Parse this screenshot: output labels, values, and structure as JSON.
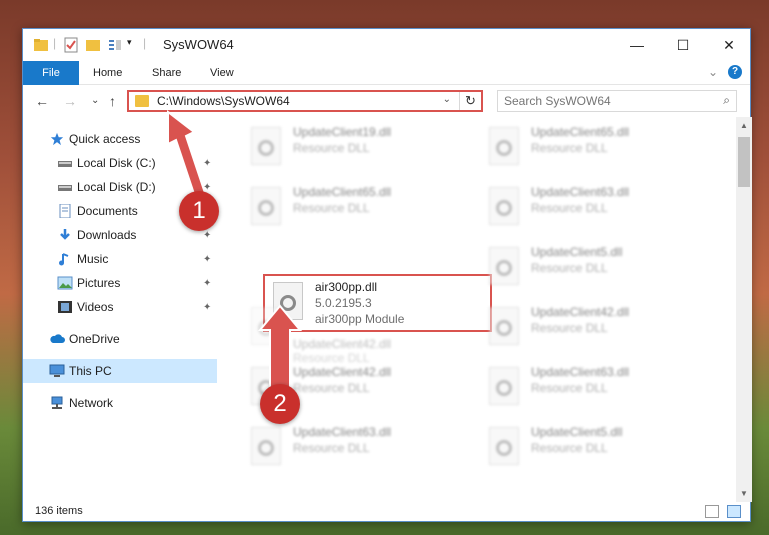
{
  "window": {
    "title": "SysWOW64",
    "controls": {
      "minimize": "—",
      "maximize": "☐",
      "close": "✕"
    }
  },
  "ribbon": {
    "tabs": [
      "File",
      "Home",
      "Share",
      "View"
    ],
    "expand": "⌄",
    "help": "?"
  },
  "nav": {
    "back": "←",
    "forward": "→",
    "recent": "⌄",
    "up": "↑",
    "address_path": "C:\\Windows\\SysWOW64",
    "dropdown": "⌄",
    "refresh": "↻",
    "search_placeholder": "Search SysWOW64",
    "search_icon": "⌕"
  },
  "sidebar": {
    "items": [
      {
        "label": "Quick access",
        "icon": "star-icon",
        "pinned": false
      },
      {
        "label": "Local Disk (C:)",
        "icon": "drive-icon",
        "pinned": true
      },
      {
        "label": "Local Disk (D:)",
        "icon": "drive-icon",
        "pinned": true
      },
      {
        "label": "Documents",
        "icon": "documents-icon",
        "pinned": true
      },
      {
        "label": "Downloads",
        "icon": "downloads-icon",
        "pinned": true
      },
      {
        "label": "Music",
        "icon": "music-icon",
        "pinned": true
      },
      {
        "label": "Pictures",
        "icon": "pictures-icon",
        "pinned": true
      },
      {
        "label": "Videos",
        "icon": "videos-icon",
        "pinned": true
      },
      {
        "label": "OneDrive",
        "icon": "cloud-icon",
        "pinned": false
      },
      {
        "label": "This PC",
        "icon": "computer-icon",
        "pinned": false,
        "selected": true
      },
      {
        "label": "Network",
        "icon": "network-icon",
        "pinned": false
      }
    ],
    "pin_glyph": "📌"
  },
  "files": [
    {
      "name": "UpdateClient19.dll",
      "sub": "Resource DLL"
    },
    {
      "name": "UpdateClient65.dll",
      "sub": "Resource DLL"
    },
    {
      "name": "UpdateClient65.dll",
      "sub": "Resource DLL"
    },
    {
      "name": "UpdateClient63.dll",
      "sub": "Resource DLL"
    },
    {
      "name": "air300pp.dll",
      "sub": "5.0.2195.3",
      "sub2": "air300pp Module",
      "highlighted": true
    },
    {
      "name": "UpdateClient5.dll",
      "sub": "Resource DLL"
    },
    {
      "name": "UpdateClient42.dll",
      "sub": "Resource DLL"
    },
    {
      "name": "UpdateClient42.dll",
      "sub": "Resource DLL"
    },
    {
      "name": "UpdateClient42.dll",
      "sub": "Resource DLL"
    },
    {
      "name": "UpdateClient63.dll",
      "sub": "Resource DLL"
    },
    {
      "name": "UpdateClient63.dll",
      "sub": "Resource DLL"
    },
    {
      "name": "UpdateClient5.dll",
      "sub": "Resource DLL"
    }
  ],
  "status": {
    "item_count": "136 items"
  },
  "annotations": {
    "step1": "1",
    "step2": "2",
    "color": "#c9302c"
  }
}
